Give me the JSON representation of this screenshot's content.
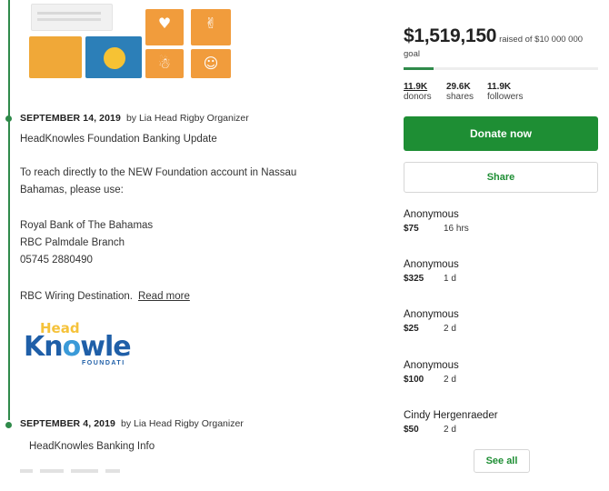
{
  "campaign": {
    "raised": "$1,519,150",
    "goal_text": "raised of $10 000 000",
    "goal_word": "goal",
    "progress_fraction": 0.152,
    "colors": {
      "accent": "#1e8e34",
      "timeline": "#2f8a4a"
    }
  },
  "stats": {
    "donors_count": "11.9K",
    "donors_label": "donors",
    "shares_count": "29.6K",
    "shares_label": "shares",
    "followers_count": "11.9K",
    "followers_label": "followers"
  },
  "actions": {
    "donate_label": "Donate now",
    "share_label": "Share",
    "see_all_label": "See all"
  },
  "donations": [
    {
      "name": "Anonymous",
      "amount": "$75",
      "time": "16 hrs"
    },
    {
      "name": "Anonymous",
      "amount": "$325",
      "time": "1 d"
    },
    {
      "name": "Anonymous",
      "amount": "$25",
      "time": "2 d"
    },
    {
      "name": "Anonymous",
      "amount": "$100",
      "time": "2 d"
    },
    {
      "name": "Cindy Hergenraeder",
      "amount": "$50",
      "time": "2 d"
    }
  ],
  "updates": [
    {
      "date": "SEPTEMBER 14, 2019",
      "byline": "by Lia Head Rigby Organizer",
      "title": "HeadKnowles Foundation Banking Update",
      "para1_line1": "To reach directly to the NEW Foundation account in Nassau",
      "para1_line2": "Bahamas, please use:",
      "bank_line1": "Royal Bank of The Bahamas",
      "bank_line2": "RBC   Palmdale Branch",
      "bank_line3": "05745   2880490",
      "wiring": "RBC Wiring Destination.",
      "read_more": "Read more",
      "logo_head": "Head",
      "logo_word_a": "Kn",
      "logo_word_o": "o",
      "logo_word_b": "wle",
      "logo_sub": "FOUNDATI"
    },
    {
      "date": "SEPTEMBER 4, 2019",
      "byline": "by Lia Head Rigby Organizer",
      "title": "HeadKnowles Banking Info"
    }
  ],
  "icons": [
    "heart-icon",
    "family-icon",
    "people-icon",
    "hands-icon",
    "coin-icon"
  ]
}
